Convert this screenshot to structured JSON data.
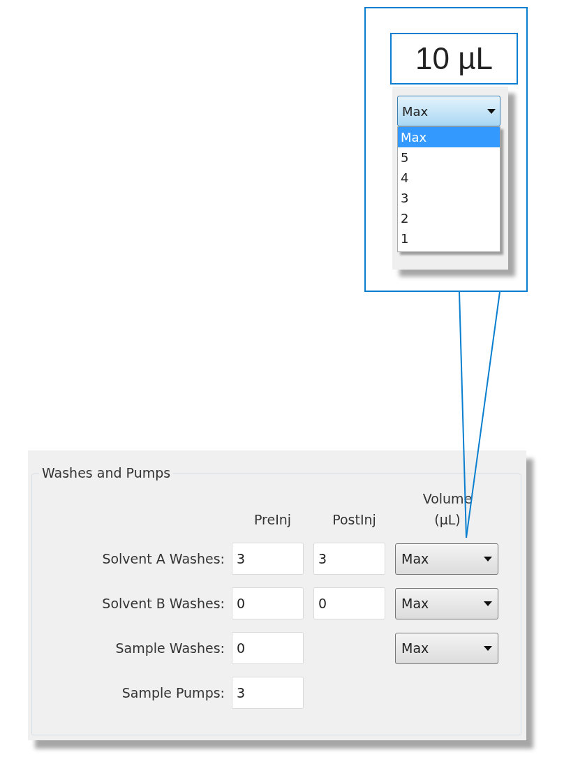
{
  "callout": {
    "value_label": "10 µL",
    "dropdown": {
      "value": "Max",
      "options": [
        {
          "label": "Max",
          "selected": true
        },
        {
          "label": "5",
          "selected": false
        },
        {
          "label": "4",
          "selected": false
        },
        {
          "label": "3",
          "selected": false
        },
        {
          "label": "2",
          "selected": false
        },
        {
          "label": "1",
          "selected": false
        }
      ]
    }
  },
  "group": {
    "title": "Washes and Pumps",
    "columns": [
      "PreInj",
      "PostInj",
      "Volume (µL)"
    ],
    "rows": [
      {
        "label": "Solvent A Washes:",
        "preinj": "3",
        "postinj": "3",
        "volume": "Max"
      },
      {
        "label": "Solvent B Washes:",
        "preinj": "0",
        "postinj": "0",
        "volume": "Max"
      },
      {
        "label": "Sample Washes:",
        "preinj": "0",
        "volume": "Max"
      },
      {
        "label": "Sample Pumps:",
        "preinj": "3"
      }
    ]
  }
}
